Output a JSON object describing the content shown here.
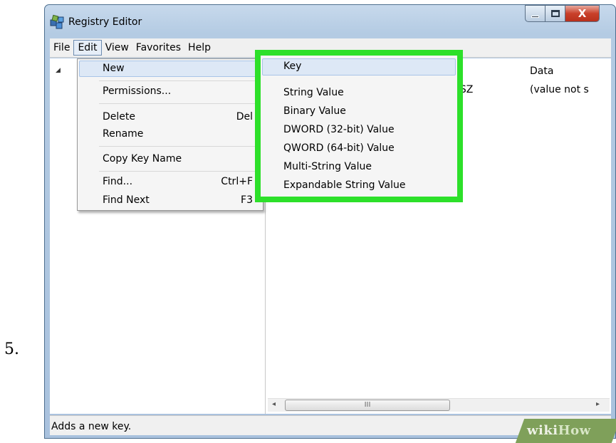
{
  "step_number": "5.",
  "window": {
    "title": "Registry Editor",
    "close_glyph": "X"
  },
  "menubar": [
    "File",
    "Edit",
    "View",
    "Favorites",
    "Help"
  ],
  "list": {
    "col_type": "pe",
    "col_data": "Data",
    "row_type": "G_SZ",
    "row_data": "(value not s"
  },
  "edit_menu": {
    "items": [
      {
        "label": "New",
        "shortcut": ""
      },
      {
        "label": "Permissions...",
        "shortcut": ""
      },
      {
        "label": "Delete",
        "shortcut": "Del"
      },
      {
        "label": "Rename",
        "shortcut": ""
      },
      {
        "label": "Copy Key Name",
        "shortcut": ""
      },
      {
        "label": "Find...",
        "shortcut": "Ctrl+F"
      },
      {
        "label": "Find Next",
        "shortcut": "F3"
      }
    ]
  },
  "new_submenu": {
    "items": [
      "Key",
      "String Value",
      "Binary Value",
      "DWORD (32-bit) Value",
      "QWORD (64-bit) Value",
      "Multi-String Value",
      "Expandable String Value"
    ],
    "highlight_color": "#2de02a"
  },
  "scrollbar": {
    "left": "◂",
    "right": "▸",
    "thumb": "III"
  },
  "status": "Adds a new key.",
  "watermark": {
    "wiki": "wiki",
    "how": "How"
  }
}
